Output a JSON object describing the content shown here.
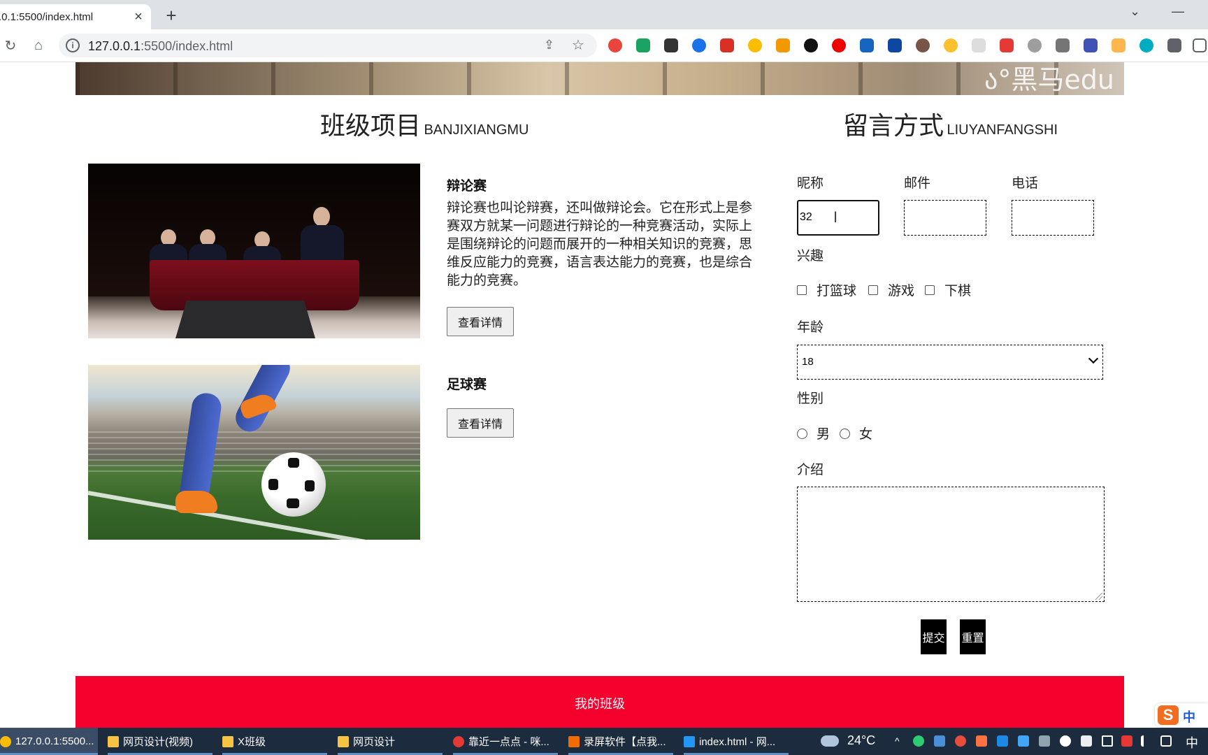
{
  "browser": {
    "tab_title": ".0.1:5500/index.html",
    "tab_close": "×",
    "new_tab": "+",
    "url_host": "127.0.0.1",
    "url_rest": ":5500/index.html",
    "info_glyph": "i"
  },
  "page": {
    "watermark": "ა°黑马edu",
    "projects_title": {
      "cn": "班级项目",
      "en": "BANJIXIANGMU"
    },
    "message_title": {
      "cn": "留言方式",
      "en": "LIUYANFANGSHI"
    },
    "projects": [
      {
        "title": "辩论赛",
        "description": "辩论赛也叫论辩赛，还叫做辩论会。它在形式上是参赛双方就某一问题进行辩论的一种竞赛活动，实际上是围绕辩论的问题而展开的一种相关知识的竞赛，思维反应能力的竞赛，语言表达能力的竞赛，也是综合能力的竞赛。",
        "button": "查看详情",
        "image": "debate-stage-photo"
      },
      {
        "title": "足球赛",
        "button": "查看详情",
        "image": "football-kick-photo"
      }
    ],
    "form": {
      "nickname_label": "昵称",
      "nickname_value": "32",
      "email_label": "邮件",
      "phone_label": "电话",
      "hobby_label": "兴趣",
      "hobbies": [
        "打篮球",
        "游戏",
        "下棋"
      ],
      "age_label": "年龄",
      "age_value": "18",
      "gender_label": "性别",
      "genders": [
        "男",
        "女"
      ],
      "intro_label": "介绍",
      "submit": "提交",
      "reset": "重置"
    },
    "footer": "我的班级",
    "accent_color": "#f5002d"
  },
  "ime": {
    "logo": "S",
    "mode": "中"
  },
  "taskbar": {
    "items": [
      {
        "label": "127.0.0.1:5500...",
        "icon": "chrome-icon",
        "active": true
      },
      {
        "label": "网页设计(视频)",
        "icon": "folder-icon"
      },
      {
        "label": "X班级",
        "icon": "folder-icon"
      },
      {
        "label": "网页设计",
        "icon": "folder-icon"
      },
      {
        "label": "靠近一点点 - 咪...",
        "icon": "music-icon"
      },
      {
        "label": "录屏软件【点我...",
        "icon": "recorder-icon"
      },
      {
        "label": "index.html - 网...",
        "icon": "vscode-icon"
      }
    ],
    "weather": "24°C",
    "input_mode": "中"
  }
}
